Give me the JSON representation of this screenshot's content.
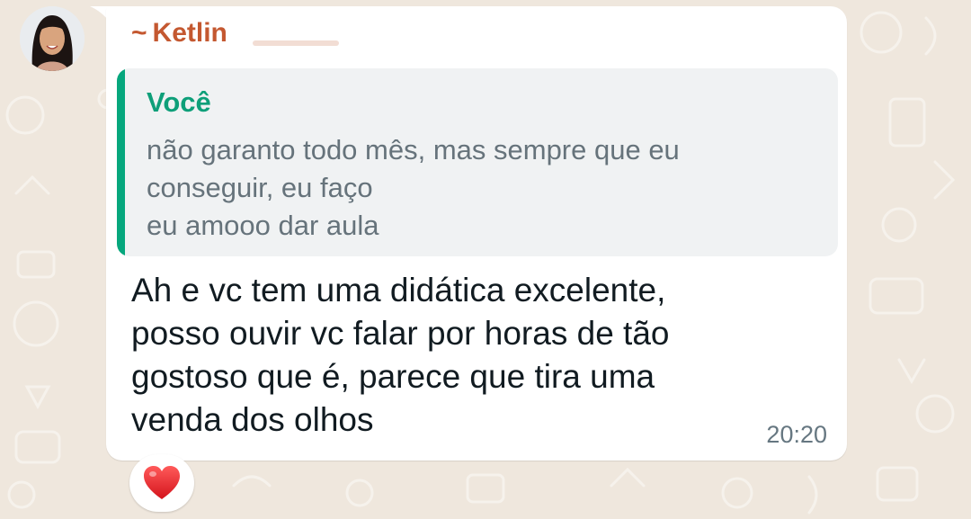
{
  "contact": {
    "sender_prefix": "~",
    "sender_name": "Ketlin"
  },
  "quoted_message": {
    "author": "Você",
    "lines": [
      "não garanto todo mês, mas sempre que eu",
      "conseguir, eu faço",
      "eu amooo dar aula"
    ]
  },
  "message": {
    "lines": [
      "Ah e vc tem uma didática excelente,",
      "posso ouvir vc falar por horas de tão",
      "gostoso que é, parece que tira uma",
      "venda dos olhos"
    ],
    "time": "20:20"
  },
  "reaction": {
    "icon": "heart-icon"
  },
  "colors": {
    "bubble": "#ffffff",
    "sender_name": "#c45830",
    "quote_author": "#0e9f79",
    "quote_bar": "#06a77d",
    "quote_background": "#f0f2f3",
    "heart": "#e02424",
    "wallpaper": "#efe7dd"
  }
}
